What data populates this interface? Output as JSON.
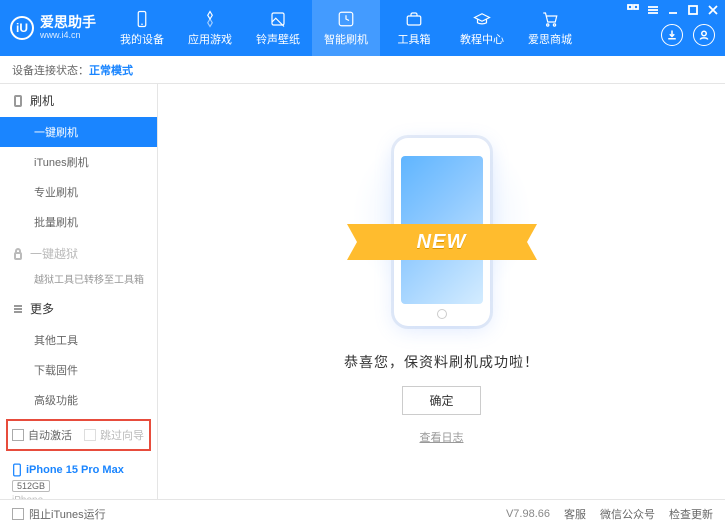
{
  "header": {
    "logoLetter": "iU",
    "title": "爱思助手",
    "subtitle": "www.i4.cn",
    "nav": [
      {
        "label": "我的设备"
      },
      {
        "label": "应用游戏"
      },
      {
        "label": "铃声壁纸"
      },
      {
        "label": "智能刷机"
      },
      {
        "label": "工具箱"
      },
      {
        "label": "教程中心"
      },
      {
        "label": "爱思商城"
      }
    ]
  },
  "status": {
    "prefix": "设备连接状态：",
    "mode": "正常模式"
  },
  "sidebar": {
    "group1": "刷机",
    "items1": [
      "一键刷机",
      "iTunes刷机",
      "专业刷机",
      "批量刷机"
    ],
    "group2": "一键越狱",
    "jailbreakInfo": "越狱工具已转移至工具箱",
    "group3": "更多",
    "items3": [
      "其他工具",
      "下载固件",
      "高级功能"
    ],
    "checkbox1": "自动激活",
    "checkbox2": "跳过向导",
    "device": {
      "name": "iPhone 15 Pro Max",
      "storage": "512GB",
      "type": "iPhone"
    }
  },
  "main": {
    "newBadge": "NEW",
    "successMsg": "恭喜您，保资料刷机成功啦！",
    "okBtn": "确定",
    "logLink": "查看日志"
  },
  "footer": {
    "blockItunes": "阻止iTunes运行",
    "version": "V7.98.66",
    "links": [
      "客服",
      "微信公众号",
      "检查更新"
    ]
  }
}
